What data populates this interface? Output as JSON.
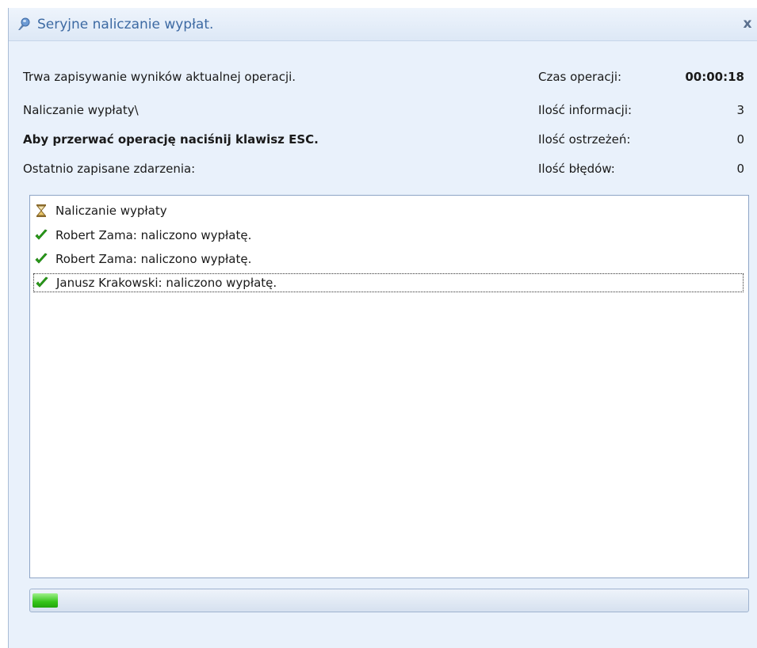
{
  "window": {
    "title": "Seryjne naliczanie wypłat.",
    "close_label": "x"
  },
  "status": {
    "line1": "Trwa zapisywanie wyników aktualnej operacji.",
    "line2": "Naliczanie wypłaty\\",
    "line3": "Aby przerwać operację naciśnij klawisz ESC.",
    "line4": "Ostatnio zapisane zdarzenia:"
  },
  "stats": {
    "time_label": "Czas operacji:",
    "time_value": "00:00:18",
    "info_label": "Ilość informacji:",
    "info_value": "3",
    "warnings_label": "Ilość ostrzeżeń:",
    "warnings_value": "0",
    "errors_label": "Ilość błędów:",
    "errors_value": "0"
  },
  "log": {
    "items": [
      {
        "text": "Naliczanie wypłaty",
        "icon": "hourglass-icon"
      },
      {
        "text": "Robert Zama: naliczono wypłatę.",
        "icon": "checkmark-icon"
      },
      {
        "text": "Robert Zama: naliczono wypłatę.",
        "icon": "checkmark-icon"
      },
      {
        "text": "Janusz Krakowski: naliczono wypłatę.",
        "icon": "checkmark-icon"
      }
    ]
  },
  "progress": {
    "fraction": 0.035,
    "color": "#34c418"
  },
  "colors": {
    "title_text": "#3d6aa3",
    "dialog_bg": "#e9f1fb",
    "check_green": "#2aa11a"
  }
}
